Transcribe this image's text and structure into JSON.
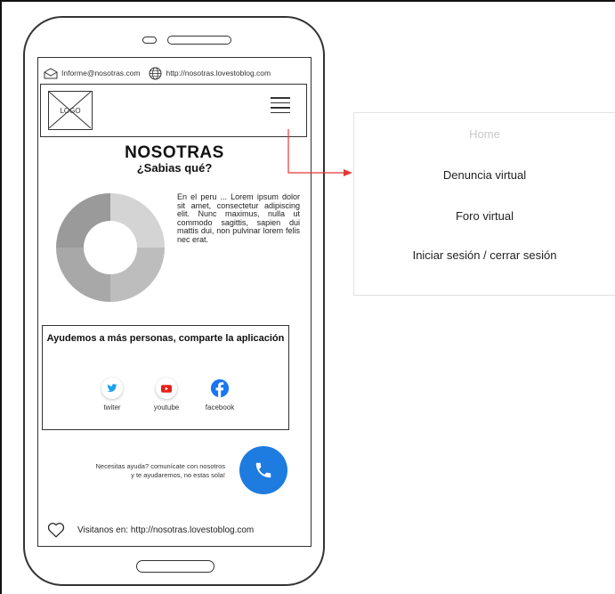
{
  "contact": {
    "email": "Informe@nosotras.com",
    "url": "http://nosotras.lovestoblog.com"
  },
  "header": {
    "logo_label": "LOGO"
  },
  "main": {
    "title": "NOSOTRAS",
    "subtitle": "¿Sabias qué?",
    "paragraph": "En el peru ... Lorem ipsum dolor sit amet, consectetur adipiscing elit. Nunc maximus, nulla ut commodo sagittis, sapien dui mattis dui, non pulvinar lorem felis nec erat."
  },
  "share": {
    "title": "Ayudemos a más personas, comparte la aplicación",
    "items": [
      {
        "label": "twiter",
        "icon": "twitter-icon",
        "color": "#1da1f2"
      },
      {
        "label": "youtube",
        "icon": "youtube-icon",
        "color": "#e62117"
      },
      {
        "label": "facebook",
        "icon": "facebook-icon",
        "color": "#1877f2"
      }
    ]
  },
  "help": {
    "line1": "Necesitas ayuda? comunícate con nosotros",
    "line2": "y te ayudaremos, no estas sola!",
    "call_color": "#1e7be0"
  },
  "footer": {
    "text": "Visitanos en: http://nosotras.lovestoblog.com"
  },
  "menu": {
    "items": [
      {
        "label": "Home",
        "state": "inactive"
      },
      {
        "label": "Denuncia virtual"
      },
      {
        "label": "Foro virtual"
      },
      {
        "label": "Iniciar sesión / cerrar sesión"
      }
    ]
  },
  "colors": {
    "arrow": "#e53935",
    "donut": [
      "#d4d4d4",
      "#bdbdbd",
      "#a8a8a8",
      "#9a9a9a"
    ]
  }
}
